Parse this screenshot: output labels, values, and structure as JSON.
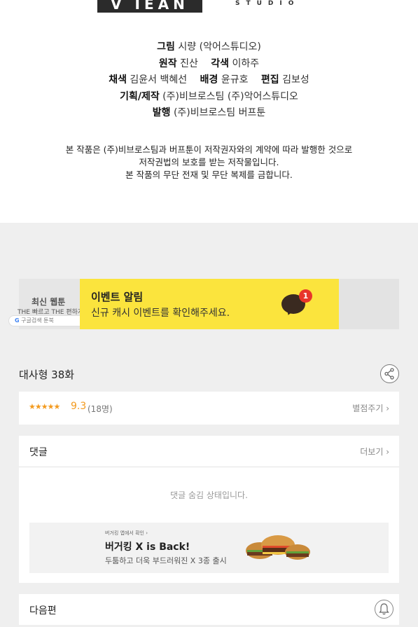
{
  "logo": {
    "mark": "V IEAN",
    "studio": "STUDIO"
  },
  "credits": [
    {
      "parts": [
        {
          "label": "그림",
          "value": "시량 (악어스튜디오)"
        }
      ]
    },
    {
      "parts": [
        {
          "label": "원작",
          "value": "진산"
        },
        {
          "label": "각색",
          "value": "이하주"
        }
      ]
    },
    {
      "parts": [
        {
          "label": "채색",
          "value": "김윤서  백혜선"
        },
        {
          "label": "배경",
          "value": "윤규호"
        },
        {
          "label": "편집",
          "value": "김보성"
        }
      ]
    },
    {
      "parts": [
        {
          "label": "기획/제작",
          "value": "(주)비브로스팀   (주)악어스튜디오"
        }
      ]
    },
    {
      "parts": [
        {
          "label": "발행",
          "value": "(주)비브로스팀   버프툰"
        }
      ]
    }
  ],
  "notice": [
    "본 작품은 (주)비브로스팀과 버프툰이 저작권자와의 계약에 따라 발행한 것으로",
    "저작권법의 보호를 받는 저작물입니다.",
    "본 작품의 무단 전재 및 무단 복제를 금합니다."
  ],
  "banner": {
    "left_title": "최신 웹툰",
    "left_sub": "THE 빠르고 THE 편하게",
    "left_pill": "구글검색  툰북",
    "title": "이벤트 알림",
    "subtitle": "신규 캐시 이벤트를 확인해주세요.",
    "badge_count": "1",
    "icon": "chat-bubble-icon"
  },
  "episode": {
    "title": "대사형 38화",
    "share_icon": "share-icon"
  },
  "rating": {
    "stars": "★★★★★",
    "score": "9.3",
    "count": "(18명)",
    "rate_link": "별점주기 ›",
    "star_color": "#f39a1e"
  },
  "comments": {
    "header": "댓글",
    "more": "더보기 ›",
    "hidden_message": "댓글 숨김 상태입니다."
  },
  "ad": {
    "small": "버거킹 앱에서 확인 ›",
    "title": "버거킹 X is Back!",
    "desc": "두툼하고 더욱 부드러워진 X 3종 출시"
  },
  "next": {
    "header": "다음편",
    "bell_icon": "bell-icon"
  }
}
